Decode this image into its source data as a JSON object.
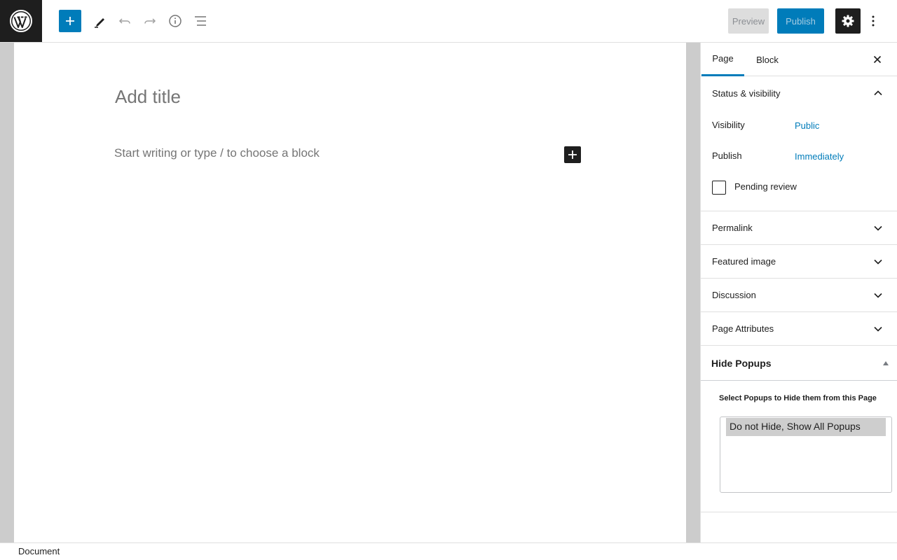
{
  "toolbar": {
    "preview_label": "Preview",
    "publish_label": "Publish",
    "icons": [
      "wordpress-logo",
      "plus-icon",
      "pencil-icon",
      "undo-icon",
      "redo-icon",
      "info-icon",
      "list-view-icon",
      "gear-icon",
      "more-vertical-icon"
    ]
  },
  "editor": {
    "title_placeholder": "Add title",
    "block_placeholder": "Start writing or type / to choose a block"
  },
  "sidebar": {
    "tabs": [
      "Page",
      "Block"
    ],
    "active_tab": "Page",
    "status_visibility": {
      "title": "Status & visibility",
      "visibility_label": "Visibility",
      "visibility_value": "Public",
      "publish_label": "Publish",
      "publish_value": "Immediately",
      "pending_review_label": "Pending review",
      "pending_review_checked": false
    },
    "panels": [
      "Permalink",
      "Featured image",
      "Discussion",
      "Page Attributes"
    ],
    "hide_popups": {
      "title": "Hide Popups",
      "label": "Select Popups to Hide them from this Page",
      "options": [
        "Do not Hide, Show All Popups"
      ]
    }
  },
  "footer": {
    "breadcrumb": "Document"
  },
  "colors": {
    "accent": "#007cba",
    "dark": "#1e1e1e",
    "editor_bg": "#cccccc"
  }
}
